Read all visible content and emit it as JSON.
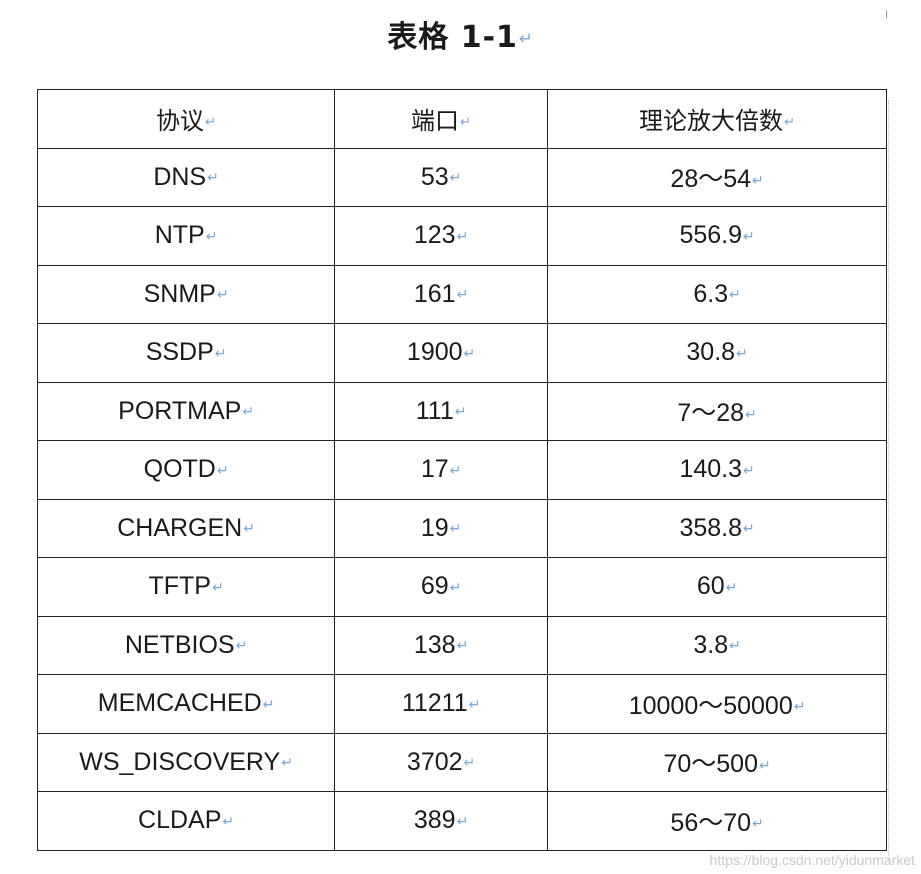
{
  "title": "表格 1-1",
  "para_mark": "↵",
  "headers": [
    "协议",
    "端口",
    "理论放大倍数"
  ],
  "rows": [
    [
      "DNS",
      "53",
      "28～54"
    ],
    [
      "NTP",
      "123",
      "556.9"
    ],
    [
      "SNMP",
      "161",
      "6.3"
    ],
    [
      "SSDP",
      "1900",
      "30.8"
    ],
    [
      "PORTMAP",
      "111",
      "7～28"
    ],
    [
      "QOTD",
      "17",
      "140.3"
    ],
    [
      "CHARGEN",
      "19",
      "358.8"
    ],
    [
      "TFTP",
      "69",
      "60"
    ],
    [
      "NETBIOS",
      "138",
      "3.8"
    ],
    [
      "MEMCACHED",
      "11211",
      "10000～50000"
    ],
    [
      "WS_DISCOVERY",
      "3702",
      "70～500"
    ],
    [
      "CLDAP",
      "389",
      "56～70"
    ]
  ],
  "watermark": "https://blog.csdn.net/yidunmarket"
}
